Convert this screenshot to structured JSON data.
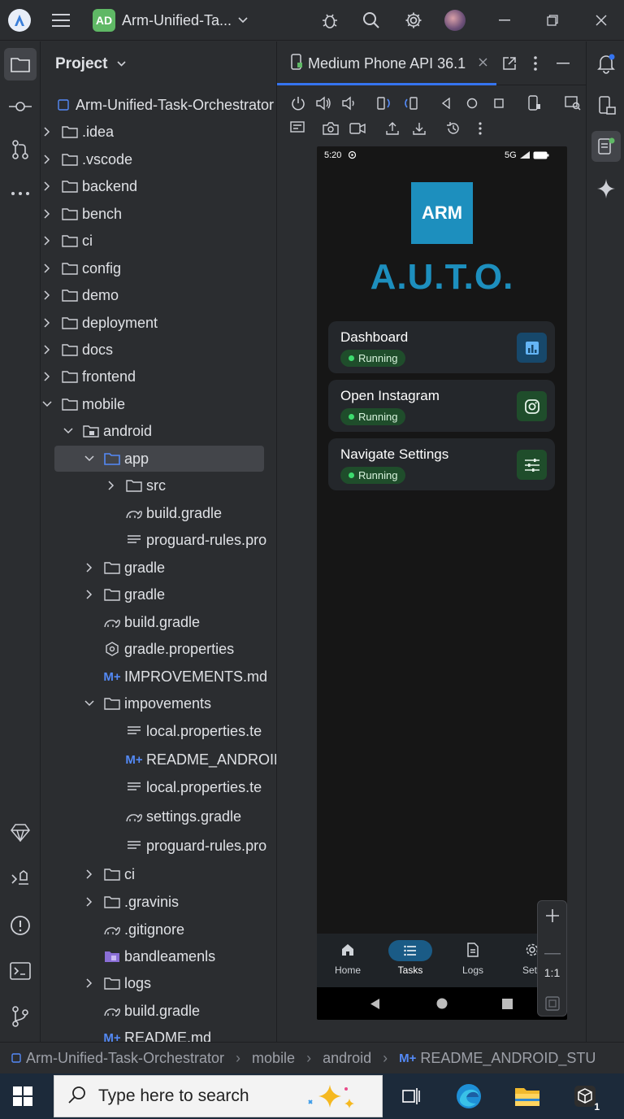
{
  "titlebar": {
    "project_badge": "AD",
    "project_name": "Arm-Unified-Ta...",
    "icons": [
      "app-logo-icon",
      "hamburger-menu-icon",
      "chevron-down-icon",
      "bug-icon",
      "search-icon",
      "gear-icon",
      "avatar"
    ]
  },
  "project_panel": {
    "title": "Project",
    "tree": [
      {
        "label": "Arm-Unified-Task-Orchestrator",
        "depth": 0,
        "kind": "root",
        "expanded": true
      },
      {
        "label": ".idea",
        "depth": 1,
        "kind": "folder",
        "expanded": false
      },
      {
        "label": ".vscode",
        "depth": 1,
        "kind": "folder",
        "expanded": false
      },
      {
        "label": "backend",
        "depth": 1,
        "kind": "folder",
        "expanded": false
      },
      {
        "label": "bench",
        "depth": 1,
        "kind": "folder",
        "expanded": false
      },
      {
        "label": "ci",
        "depth": 1,
        "kind": "folder",
        "expanded": false
      },
      {
        "label": "config",
        "depth": 1,
        "kind": "folder",
        "expanded": false
      },
      {
        "label": "demo",
        "depth": 1,
        "kind": "folder",
        "expanded": false
      },
      {
        "label": "deployment",
        "depth": 1,
        "kind": "folder",
        "expanded": false
      },
      {
        "label": "docs",
        "depth": 1,
        "kind": "folder",
        "expanded": false
      },
      {
        "label": "frontend",
        "depth": 1,
        "kind": "folder",
        "expanded": false
      },
      {
        "label": "mobile",
        "depth": 1,
        "kind": "folder",
        "expanded": true
      },
      {
        "label": "android",
        "depth": 2,
        "kind": "module",
        "expanded": true
      },
      {
        "label": "app",
        "depth": 3,
        "kind": "folder-blue",
        "expanded": true,
        "selected": true
      },
      {
        "label": "src",
        "depth": 4,
        "kind": "folder",
        "expanded": false
      },
      {
        "label": "build.gradle",
        "depth": 4,
        "kind": "gradle"
      },
      {
        "label": "proguard-rules.pro",
        "depth": 4,
        "kind": "text"
      },
      {
        "label": "gradle",
        "depth": 3,
        "kind": "folder",
        "expanded": false
      },
      {
        "label": "gradle",
        "depth": 3,
        "kind": "folder",
        "expanded": false
      },
      {
        "label": "build.gradle",
        "depth": 3,
        "kind": "gradle"
      },
      {
        "label": "gradle.properties",
        "depth": 3,
        "kind": "settings"
      },
      {
        "label": "IMPROVEMENTS.md",
        "depth": 3,
        "kind": "markdown"
      },
      {
        "label": "impovements",
        "depth": 3,
        "kind": "folder",
        "expanded": true
      },
      {
        "label": "local.properties.te",
        "depth": 4,
        "kind": "text"
      },
      {
        "label": "README_ANDROID",
        "depth": 4,
        "kind": "markdown"
      },
      {
        "label": "local.properties.te",
        "depth": 4,
        "kind": "text"
      },
      {
        "label": "settings.gradle",
        "depth": 4,
        "kind": "gradle"
      },
      {
        "label": "proguard-rules.pro",
        "depth": 4,
        "kind": "text"
      },
      {
        "label": "ci",
        "depth": 3,
        "kind": "folder",
        "expanded": false
      },
      {
        "label": ".gravinis",
        "depth": 3,
        "kind": "folder",
        "expanded": false
      },
      {
        "label": ".gitignore",
        "depth": 3,
        "kind": "gradle"
      },
      {
        "label": "bandleamenls",
        "depth": 3,
        "kind": "module-purple"
      },
      {
        "label": "logs",
        "depth": 3,
        "kind": "folder",
        "expanded": false
      },
      {
        "label": "build.gradle",
        "depth": 3,
        "kind": "gradle"
      },
      {
        "label": "README.md",
        "depth": 3,
        "kind": "markdown"
      }
    ]
  },
  "editor": {
    "tab_label": "Medium Phone API 36.1"
  },
  "phone": {
    "time": "5:20",
    "network": "5G",
    "logo_text": "ARM",
    "app_title": "A.U.T.O.",
    "tasks": [
      {
        "name": "Dashboard",
        "status": "Running",
        "icon": "chart-icon",
        "icon_bg": "#17486b"
      },
      {
        "name": "Open Instagram",
        "status": "Running",
        "icon": "instagram-icon",
        "icon_bg": "#1f4d2b"
      },
      {
        "name": "Navigate Settings",
        "status": "Running",
        "icon": "sliders-icon",
        "icon_bg": "#1f4d2b"
      }
    ],
    "nav": [
      {
        "label": "Home",
        "icon": "home-icon",
        "active": false
      },
      {
        "label": "Tasks",
        "icon": "list-icon",
        "active": true
      },
      {
        "label": "Logs",
        "icon": "document-icon",
        "active": false
      },
      {
        "label": "Settl",
        "icon": "gear-icon",
        "active": false
      }
    ]
  },
  "zoom": {
    "ratio_label": "1:1"
  },
  "breadcrumb": [
    "Arm-Unified-Task-Orchestrator",
    "mobile",
    "android",
    "README_ANDROID_STU"
  ],
  "taskbar": {
    "search_placeholder": "Type here to search",
    "apps": [
      "task-view-icon",
      "edge-icon",
      "file-explorer-icon",
      "app-box-icon"
    ],
    "app_badge": "1"
  },
  "colors": {
    "accent": "#3574f0",
    "arm_blue": "#1d8fbe",
    "running_green": "#3ddc6e",
    "ide_bg": "#2b2d30"
  }
}
